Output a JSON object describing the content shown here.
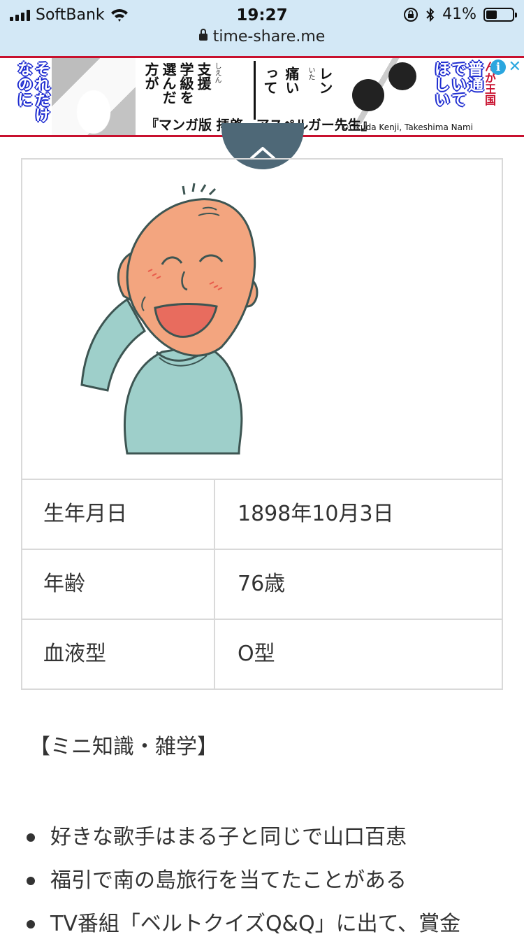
{
  "status_bar": {
    "carrier": "SoftBank",
    "time": "19:27",
    "battery": "41%",
    "battery_level": 0.41,
    "url": "time-share.me"
  },
  "ad": {
    "left_columns": [
      "それだけ",
      "なのに"
    ],
    "middle_columns": [
      "支援",
      "学級を",
      "選んだ",
      "方が"
    ],
    "ruby_shien": "しえん",
    "middle2_columns": [
      "レン",
      "痛い",
      "って"
    ],
    "ruby_itai": "いた",
    "right_columns": [
      "普通",
      "でいて",
      "ほしい"
    ],
    "right_edge": "んが王国",
    "caption": "『マンガ版 拝啓、アスペルガー先生』",
    "credit": "©Okuda Kenji, Takeshima Nami",
    "info_icon": "i",
    "close_icon": "✕"
  },
  "profile": {
    "rows": [
      {
        "label": "生年月日",
        "value": "1898年10月3日"
      },
      {
        "label": "年齢",
        "value": "76歳"
      },
      {
        "label": "血液型",
        "value": "O型"
      }
    ]
  },
  "trivia": {
    "title": "【ミニ知識・雑学】",
    "items": [
      "好きな歌手はまる子と同じで山口百恵",
      "福引で南の島旅行を当てたことがある",
      "TV番組「ベルトクイズQ&Q」に出て、賞金"
    ]
  },
  "colors": {
    "status_bg": "#d3e8f6",
    "ad_border": "#c8102e",
    "top_button": "#4e6877",
    "table_border": "#d9d9d9",
    "skin": "#f3a57f",
    "shirt": "#9ecfca"
  }
}
